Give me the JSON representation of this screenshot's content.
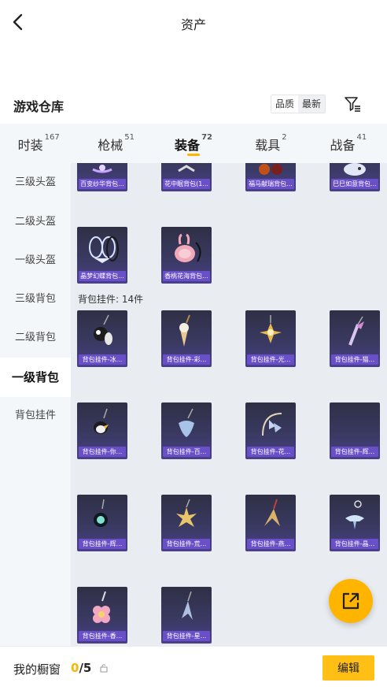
{
  "header": {
    "title": "资产",
    "back_icon": "chevron-left-icon"
  },
  "warehouse": {
    "title": "游戏仓库",
    "sort_options": [
      "品质",
      "最新"
    ],
    "filter_icon": "filter-icon"
  },
  "tabs": [
    {
      "label": "时装",
      "count": "167"
    },
    {
      "label": "枪械",
      "count": "51"
    },
    {
      "label": "装备",
      "count": "72",
      "active": true
    },
    {
      "label": "载具",
      "count": "2"
    },
    {
      "label": "战备",
      "count": "41"
    }
  ],
  "sidebar": [
    {
      "label": "三级头盔"
    },
    {
      "label": "二级头盔"
    },
    {
      "label": "一级头盔"
    },
    {
      "label": "三级背包"
    },
    {
      "label": "二级背包"
    },
    {
      "label": "一级背包",
      "active": true
    },
    {
      "label": "背包挂件"
    }
  ],
  "backpacks": [
    {
      "label": "百变纱华背包..."
    },
    {
      "label": "花中眠背包(1..."
    },
    {
      "label": "福马献瑞背包..."
    },
    {
      "label": "巳巳如意背包..."
    },
    {
      "label": "晶梦幻蝶背包..."
    },
    {
      "label": "香桃花海背包..."
    }
  ],
  "pendant_section": {
    "label": "背包挂件: 14件"
  },
  "pendants": [
    {
      "label": "背包挂件-冰..."
    },
    {
      "label": "背包挂件-彩..."
    },
    {
      "label": "背包挂件-光..."
    },
    {
      "label": "背包挂件-猫..."
    },
    {
      "label": "背包挂件-你..."
    },
    {
      "label": "背包挂件-百..."
    },
    {
      "label": "背包挂件-花..."
    },
    {
      "label": "背包挂件-辉..."
    },
    {
      "label": "背包挂件-辉..."
    },
    {
      "label": "背包挂件-荒..."
    },
    {
      "label": "背包挂件-燕..."
    },
    {
      "label": "背包挂件-晶..."
    },
    {
      "label": "背包挂件-香..."
    },
    {
      "label": "背包挂件-星..."
    }
  ],
  "bottom": {
    "my_window": "我的橱窗",
    "count_current": "0",
    "count_total": "/5",
    "edit_label": "编辑"
  },
  "fab_icon": "external-link-icon",
  "colors": {
    "accent": "#ffb400",
    "card_label": "#6a50c8"
  }
}
